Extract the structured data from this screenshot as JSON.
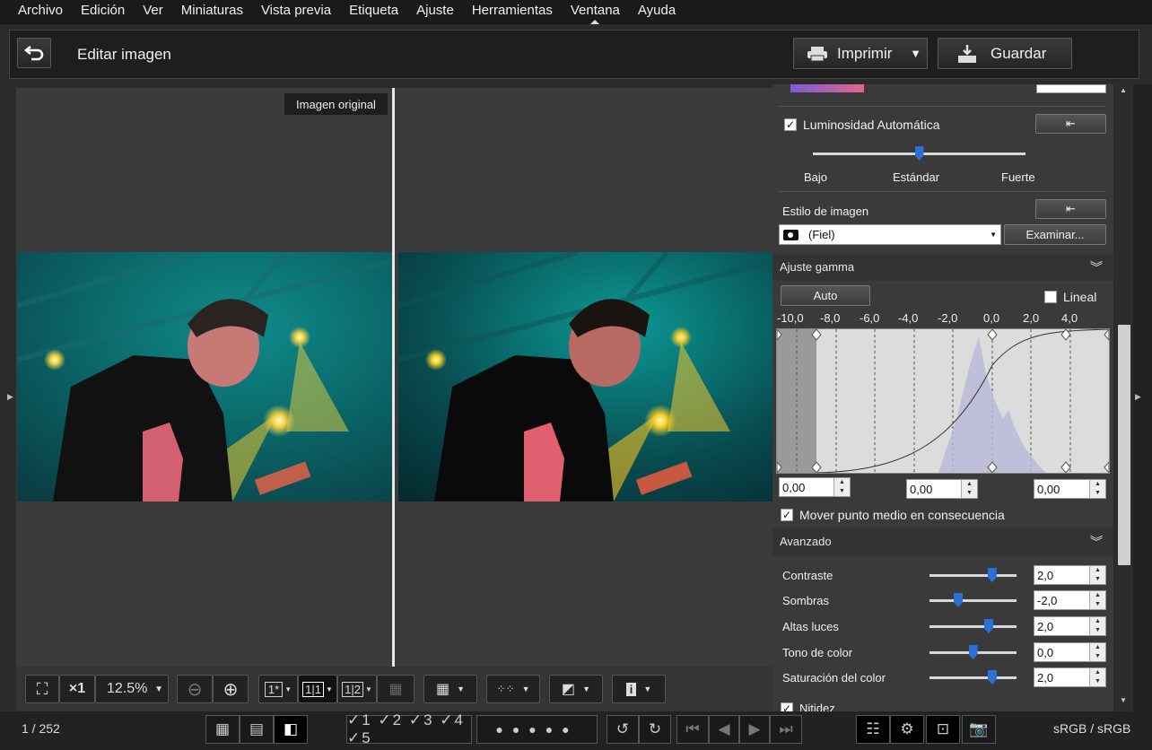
{
  "menu": [
    "Archivo",
    "Edición",
    "Ver",
    "Miniaturas",
    "Vista previa",
    "Etiqueta",
    "Ajuste",
    "Herramientas",
    "Ventana",
    "Ayuda"
  ],
  "toolbar": {
    "title": "Editar imagen",
    "print_label": "Imprimir",
    "save_label": "Guardar"
  },
  "viewer": {
    "original_label": "Imagen original"
  },
  "bottom": {
    "zoom": "12.5%",
    "x1": "×1"
  },
  "status": {
    "counter": "1 / 252",
    "colorspace": "sRGB / sRGB"
  },
  "panel": {
    "auto_luminosity": {
      "label": "Luminosidad Automática",
      "checked": true,
      "low": "Bajo",
      "std": "Estándar",
      "high": "Fuerte",
      "value": 0.5
    },
    "picture_style": {
      "label": "Estilo de imagen",
      "value": "(Fiel)",
      "browse": "Examinar..."
    },
    "gamma": {
      "title": "Ajuste gamma",
      "auto": "Auto",
      "linear": "Lineal",
      "ticks": [
        "-10,0",
        "-8,0",
        "-6,0",
        "-4,0",
        "-2,0",
        "0,0",
        "2,0",
        "4,0"
      ],
      "black": "0,00",
      "mid": "0,00",
      "white": "0,00",
      "move_mid": "Mover punto medio en consecuencia"
    },
    "advanced": {
      "title": "Avanzado",
      "rows": [
        {
          "label": "Contraste",
          "value": "2,0",
          "pos": 0.72
        },
        {
          "label": "Sombras",
          "value": "-2,0",
          "pos": 0.33
        },
        {
          "label": "Altas luces",
          "value": "2,0",
          "pos": 0.68
        },
        {
          "label": "Tono de color",
          "value": "0,0",
          "pos": 0.5
        },
        {
          "label": "Saturación del color",
          "value": "2,0",
          "pos": 0.72
        }
      ]
    },
    "sharpness": {
      "label": "Nitidez"
    }
  }
}
